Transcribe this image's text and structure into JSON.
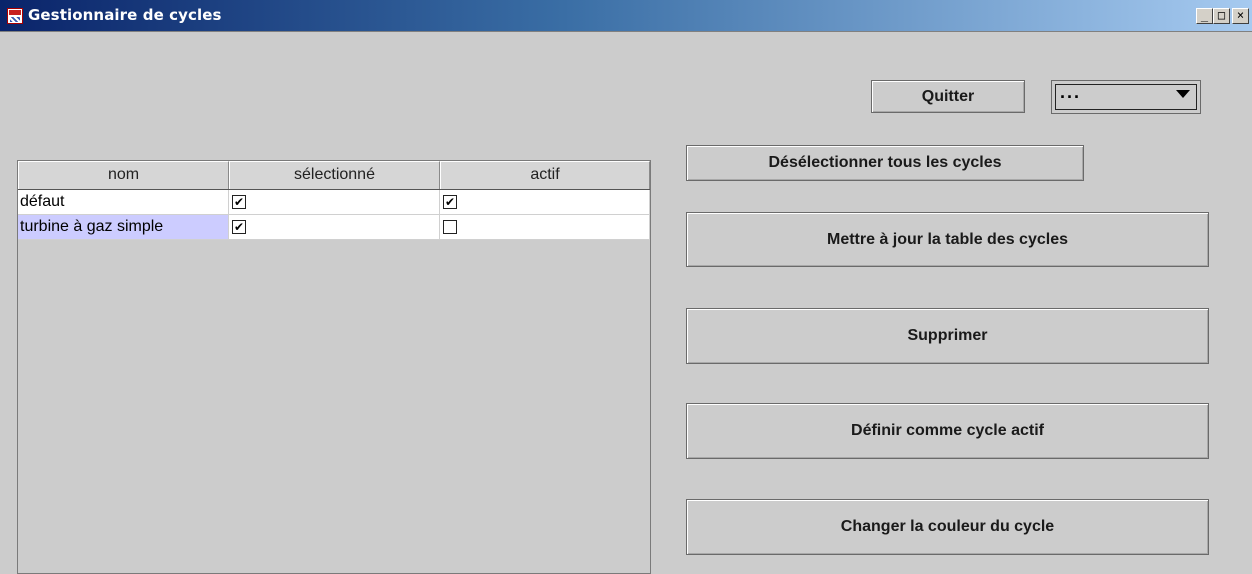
{
  "window": {
    "title": "Gestionnaire de cycles",
    "controls": {
      "minimize": "_",
      "maximize": "□",
      "close": "×"
    }
  },
  "table": {
    "headers": [
      "nom",
      "sélectionné",
      "actif"
    ],
    "rows": [
      {
        "nom": "défaut",
        "selectionne": true,
        "actif": true
      },
      {
        "nom": "turbine à gaz simple",
        "selectionne": true,
        "actif": false
      }
    ],
    "selected_row_index": 1
  },
  "toolbar": {
    "quit_label": "Quitter",
    "dropdown_value": "...",
    "deselect_all_label": "Désélectionner tous les cycles",
    "update_table_label": "Mettre à jour la table des cycles",
    "delete_label": "Supprimer",
    "set_active_label": "Définir comme cycle actif",
    "change_color_label": "Changer la couleur du cycle"
  },
  "colors": {
    "titlebar_start": "#0a246a",
    "titlebar_end": "#a6caf0",
    "selection": "#ccccff",
    "background": "#cccccc"
  }
}
